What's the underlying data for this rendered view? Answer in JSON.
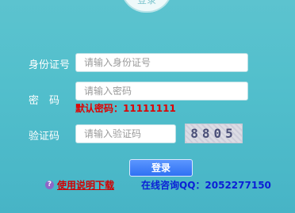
{
  "top_tab": {
    "label": "登录"
  },
  "form": {
    "id_label": "身份证号",
    "id_placeholder": "请输入身份证号",
    "password_label": "密　码",
    "password_placeholder": "请输入密码",
    "password_hint": "默认密码：11111111",
    "captcha_label": "验证码",
    "captcha_placeholder": "请输入验证码",
    "captcha_text": "8805"
  },
  "actions": {
    "login_button": "登录",
    "help_link": "使用说明下载",
    "contact": "在线咨询QQ：2052277150"
  },
  "colors": {
    "background": "#52bfcc",
    "button": "#2f71f3",
    "hint": "#e00000",
    "contact": "#0b1fd6"
  }
}
